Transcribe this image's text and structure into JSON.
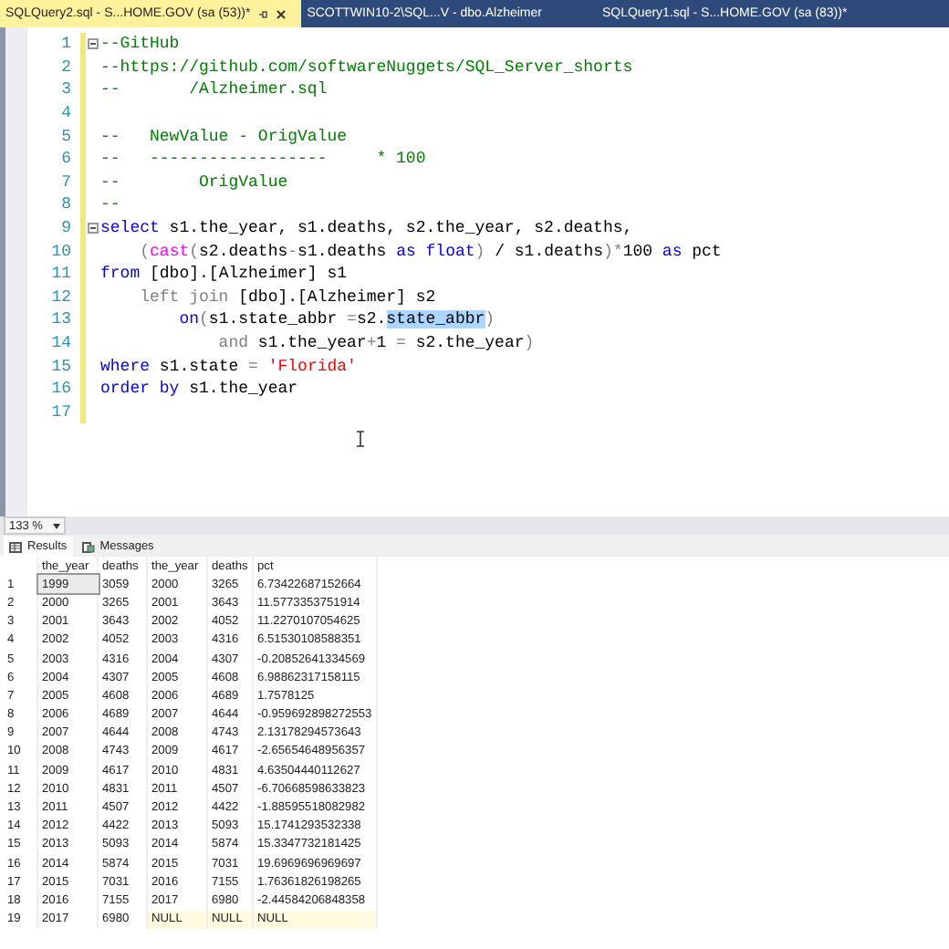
{
  "tabs": [
    {
      "label": "SQLQuery2.sql - S...HOME.GOV (sa (53))*",
      "selected": true
    },
    {
      "label": "SCOTTWIN10-2\\SQL...V - dbo.Alzheimer",
      "selected": false
    },
    {
      "label": "SQLQuery1.sql - S...HOME.GOV (sa (83))*",
      "selected": false
    }
  ],
  "editor": {
    "lines": [
      {
        "number": "1",
        "fold": true,
        "segments": [
          {
            "kind": "comment",
            "text": "--GitHub"
          }
        ]
      },
      {
        "number": "2",
        "fold": false,
        "segments": [
          {
            "kind": "comment",
            "text": "--https://github.com/softwareNuggets/SQL_Server_shorts"
          }
        ]
      },
      {
        "number": "3",
        "fold": false,
        "segments": [
          {
            "kind": "comment",
            "text": "--       /Alzheimer.sql"
          }
        ]
      },
      {
        "number": "4",
        "fold": false
      },
      {
        "number": "5",
        "fold": false,
        "segments": [
          {
            "kind": "comment",
            "text": "--   NewValue - OrigValue"
          }
        ]
      },
      {
        "number": "6",
        "fold": false,
        "segments": [
          {
            "kind": "comment",
            "text": "--   ------------------     * 100"
          }
        ]
      },
      {
        "number": "7",
        "fold": false,
        "segments": [
          {
            "kind": "comment",
            "text": "--        OrigValue"
          }
        ]
      },
      {
        "number": "8",
        "fold": false,
        "segments": [
          {
            "kind": "comment",
            "text": "--"
          }
        ]
      },
      {
        "number": "9",
        "fold": true,
        "segments": [
          {
            "kind": "keyword",
            "text": "select"
          },
          {
            "kind": "plain",
            "text": " s1.the_year, s1.deaths, s2.the_year, s2.deaths,"
          }
        ]
      },
      {
        "number": "10",
        "fold": false,
        "segments": [
          {
            "kind": "operator",
            "text": "    ("
          },
          {
            "kind": "function",
            "text": "cast"
          },
          {
            "kind": "operator",
            "text": "("
          },
          {
            "kind": "plain",
            "text": "s2.deaths"
          },
          {
            "kind": "operator",
            "text": "-"
          },
          {
            "kind": "plain",
            "text": "s1.deaths "
          },
          {
            "kind": "keyword",
            "text": "as float"
          },
          {
            "kind": "operator",
            "text": ")"
          },
          {
            "kind": "plain",
            "text": " / s1.deaths"
          },
          {
            "kind": "operator",
            "text": ")*"
          },
          {
            "kind": "plain",
            "text": "100 "
          },
          {
            "kind": "keyword",
            "text": "as"
          },
          {
            "kind": "plain",
            "text": " pct"
          }
        ]
      },
      {
        "number": "11",
        "fold": false,
        "segments": [
          {
            "kind": "keyword",
            "text": "from"
          },
          {
            "kind": "plain",
            "text": " [dbo].[Alzheimer] s1"
          }
        ]
      },
      {
        "number": "12",
        "fold": false,
        "segments": [
          {
            "kind": "operator",
            "text": "    left join"
          },
          {
            "kind": "plain",
            "text": " [dbo].[Alzheimer] s2"
          }
        ]
      },
      {
        "number": "13",
        "fold": false,
        "segments": [
          {
            "kind": "keyword",
            "text": "        on"
          },
          {
            "kind": "operator",
            "text": "("
          },
          {
            "kind": "plain",
            "text": "s1.state_abbr "
          },
          {
            "kind": "operator",
            "text": "="
          },
          {
            "kind": "plain",
            "text": "s2."
          },
          {
            "kind": "selection",
            "text": "state_abbr"
          },
          {
            "kind": "operator",
            "text": ")"
          }
        ]
      },
      {
        "number": "14",
        "fold": false,
        "segments": [
          {
            "kind": "operator",
            "text": "            and"
          },
          {
            "kind": "plain",
            "text": " s1.the_year"
          },
          {
            "kind": "operator",
            "text": "+"
          },
          {
            "kind": "plain",
            "text": "1 "
          },
          {
            "kind": "operator",
            "text": "="
          },
          {
            "kind": "plain",
            "text": " s2.the_year"
          },
          {
            "kind": "operator",
            "text": ")"
          }
        ]
      },
      {
        "number": "15",
        "fold": false,
        "segments": [
          {
            "kind": "keyword",
            "text": "where"
          },
          {
            "kind": "plain",
            "text": " s1.state "
          },
          {
            "kind": "operator",
            "text": "="
          },
          {
            "kind": "string",
            "text": " 'Florida'"
          }
        ]
      },
      {
        "number": "16",
        "fold": false,
        "segments": [
          {
            "kind": "keyword",
            "text": "order by"
          },
          {
            "kind": "plain",
            "text": " s1.the_year"
          }
        ]
      },
      {
        "number": "17",
        "fold": false
      }
    ]
  },
  "zoom": {
    "value": "133 %"
  },
  "result_tabs": [
    {
      "label": "Results",
      "selected": true
    },
    {
      "label": "Messages",
      "selected": false
    }
  ],
  "grid": {
    "columns": [
      "the_year",
      "deaths",
      "the_year",
      "deaths",
      "pct"
    ],
    "rows": [
      {
        "number": "1",
        "selected": true,
        "cells": [
          "1999",
          "3059",
          "2000",
          "3265",
          "6.73422687152664"
        ]
      },
      {
        "number": "2",
        "selected": false,
        "cells": [
          "2000",
          "3265",
          "2001",
          "3643",
          "11.5773353751914"
        ]
      },
      {
        "number": "3",
        "selected": false,
        "cells": [
          "2001",
          "3643",
          "2002",
          "4052",
          "11.2270107054625"
        ]
      },
      {
        "number": "4",
        "selected": false,
        "cells": [
          "2002",
          "4052",
          "2003",
          "4316",
          "6.51530108588351"
        ]
      },
      {
        "number": "5",
        "selected": false,
        "cells": [
          "2003",
          "4316",
          "2004",
          "4307",
          "-0.20852641334569"
        ]
      },
      {
        "number": "6",
        "selected": false,
        "cells": [
          "2004",
          "4307",
          "2005",
          "4608",
          "6.98862317158115"
        ]
      },
      {
        "number": "7",
        "selected": false,
        "cells": [
          "2005",
          "4608",
          "2006",
          "4689",
          "1.7578125"
        ]
      },
      {
        "number": "8",
        "selected": false,
        "cells": [
          "2006",
          "4689",
          "2007",
          "4644",
          "-0.959692898272553"
        ]
      },
      {
        "number": "9",
        "selected": false,
        "cells": [
          "2007",
          "4644",
          "2008",
          "4743",
          "2.13178294573643"
        ]
      },
      {
        "number": "10",
        "selected": false,
        "cells": [
          "2008",
          "4743",
          "2009",
          "4617",
          "-2.65654648956357"
        ]
      },
      {
        "number": "11",
        "selected": false,
        "cells": [
          "2009",
          "4617",
          "2010",
          "4831",
          "4.63504440112627"
        ]
      },
      {
        "number": "12",
        "selected": false,
        "cells": [
          "2010",
          "4831",
          "2011",
          "4507",
          "-6.70668598633823"
        ]
      },
      {
        "number": "13",
        "selected": false,
        "cells": [
          "2011",
          "4507",
          "2012",
          "4422",
          "-1.88595518082982"
        ]
      },
      {
        "number": "14",
        "selected": false,
        "cells": [
          "2012",
          "4422",
          "2013",
          "5093",
          "15.1741293532338"
        ]
      },
      {
        "number": "15",
        "selected": false,
        "cells": [
          "2013",
          "5093",
          "2014",
          "5874",
          "15.3347732181425"
        ]
      },
      {
        "number": "16",
        "selected": false,
        "cells": [
          "2014",
          "5874",
          "2015",
          "7031",
          "19.6969696969697"
        ]
      },
      {
        "number": "17",
        "selected": false,
        "cells": [
          "2015",
          "7031",
          "2016",
          "7155",
          "1.76361826198265"
        ]
      },
      {
        "number": "18",
        "selected": false,
        "cells": [
          "2016",
          "7155",
          "2017",
          "6980",
          "-2.44584206848358"
        ]
      },
      {
        "number": "19",
        "selected": false,
        "cells": [
          "2017",
          "6980"
        ],
        "null_cells": [
          "NULL",
          "NULL",
          "NULL"
        ]
      }
    ]
  }
}
